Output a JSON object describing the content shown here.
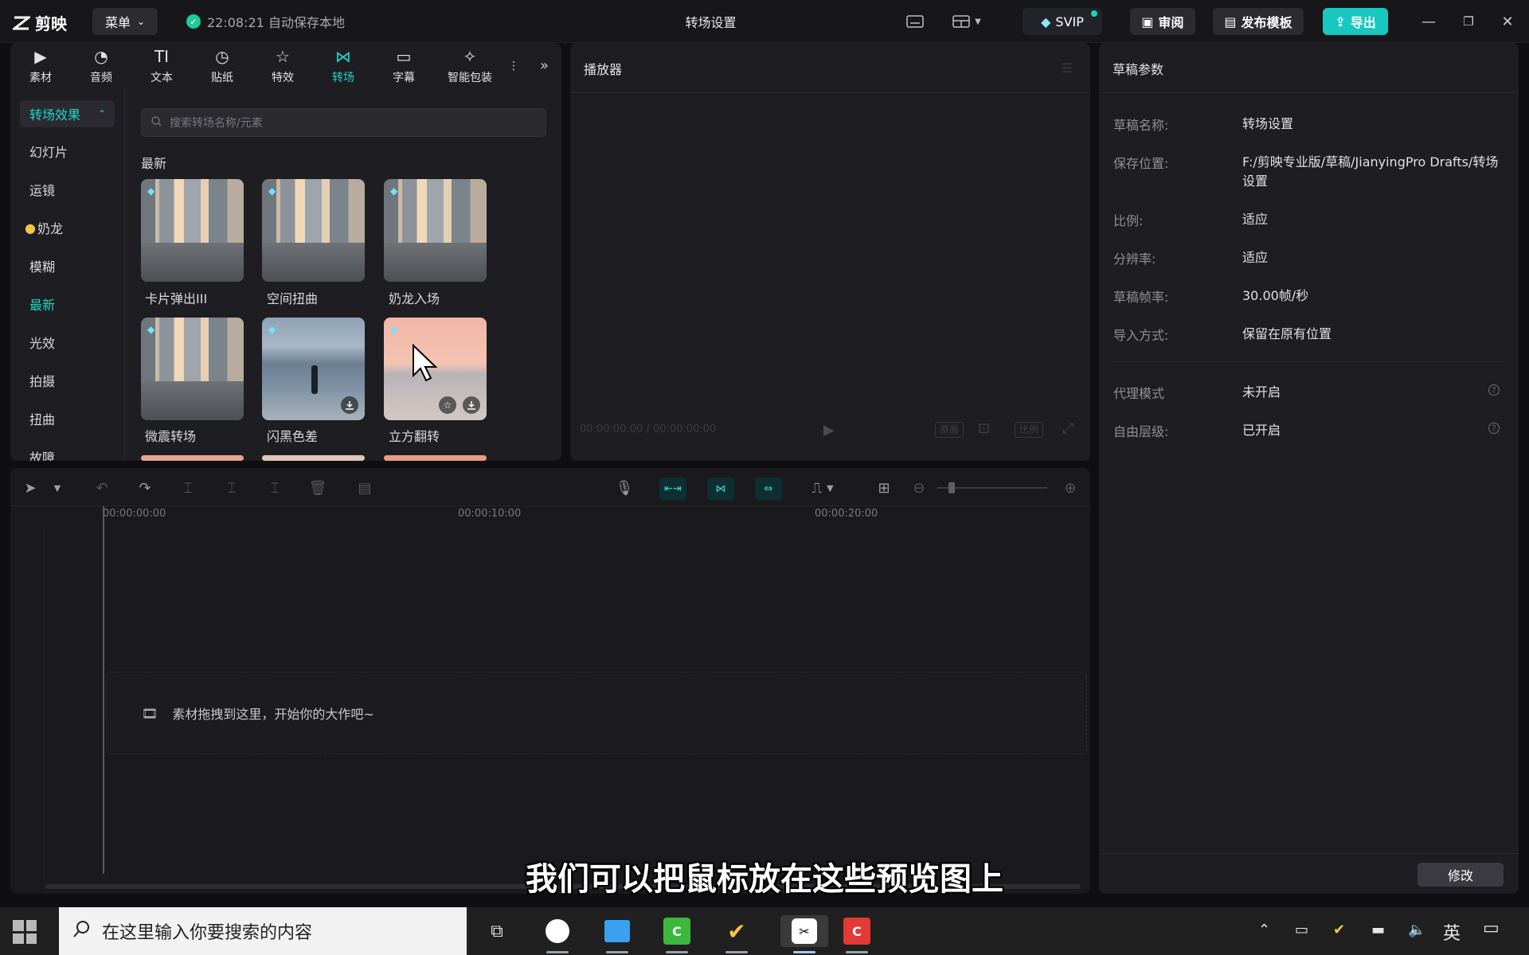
{
  "app": {
    "name": "剪映",
    "menu_label": "菜单",
    "save_status": "22:08:21 自动保存本地",
    "window_title": "转场设置"
  },
  "titlebar": {
    "svip_label": "SVIP",
    "review_label": "审阅",
    "publish_label": "发布模板",
    "export_label": "导出"
  },
  "media": {
    "tabs": [
      {
        "label": "素材",
        "icon": "media-icon"
      },
      {
        "label": "音频",
        "icon": "audio-icon"
      },
      {
        "label": "文本",
        "icon": "text-icon"
      },
      {
        "label": "贴纸",
        "icon": "sticker-icon"
      },
      {
        "label": "特效",
        "icon": "effects-icon"
      },
      {
        "label": "转场",
        "icon": "transition-icon",
        "active": true
      },
      {
        "label": "字幕",
        "icon": "caption-icon"
      },
      {
        "label": "智能包装",
        "icon": "smart-pack-icon"
      }
    ],
    "category_head": "转场效果",
    "categories": [
      "幻灯片",
      "运镜",
      "奶龙",
      "模糊",
      "最新",
      "光效",
      "拍摄",
      "扭曲",
      "故障"
    ],
    "selected_category": "最新",
    "search_placeholder": "搜索转场名称/元素",
    "section_title": "最新",
    "items": [
      "卡片弹出III",
      "空间扭曲",
      "奶龙入场",
      "微震转场",
      "闪黑色差",
      "立方翻转"
    ]
  },
  "player": {
    "title": "播放器",
    "time": "00:00:00:00 / 00:00:00:00",
    "ratio_label": "原画",
    "aspect_label": "比例"
  },
  "inspector": {
    "title": "草稿参数",
    "rows": [
      {
        "k": "草稿名称:",
        "v": "转场设置"
      },
      {
        "k": "保存位置:",
        "v": "F:/剪映专业版/草稿/JianyingPro Drafts/转场设置"
      },
      {
        "k": "比例:",
        "v": "适应"
      },
      {
        "k": "分辨率:",
        "v": "适应"
      },
      {
        "k": "草稿帧率:",
        "v": "30.00帧/秒"
      },
      {
        "k": "导入方式:",
        "v": "保留在原有位置"
      },
      {
        "k": "代理模式",
        "v": "未开启"
      },
      {
        "k": "自由层级:",
        "v": "已开启"
      }
    ],
    "edit_label": "修改"
  },
  "timeline": {
    "ticks": [
      "00:00:00:00",
      "00:00:10:00",
      "00:00:20:00"
    ],
    "drop_hint": "素材拖拽到这里，开始你的大作吧~"
  },
  "subtitle": "我们可以把鼠标放在这些预览图上",
  "taskbar": {
    "search_placeholder": "在这里输入你要搜索的内容",
    "ime": "英"
  },
  "colors": {
    "accent": "#20d4c9",
    "export": "#19c7c1",
    "panel": "#1e1e22"
  }
}
